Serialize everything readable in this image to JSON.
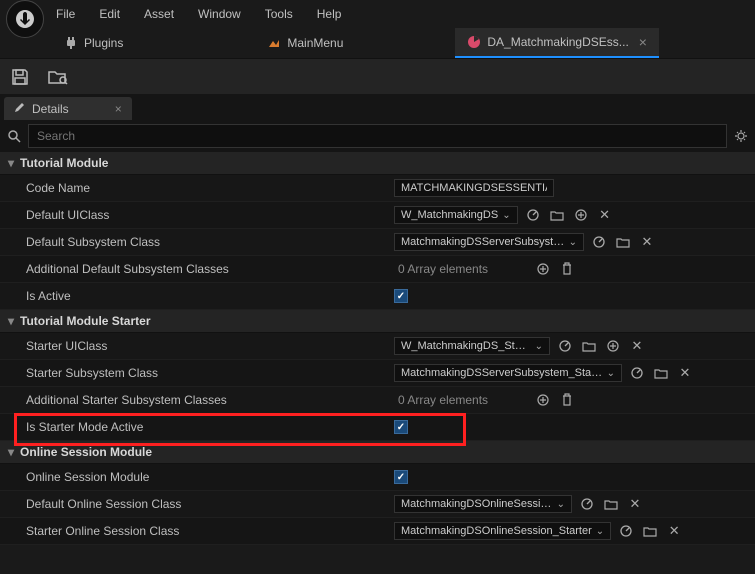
{
  "menu": {
    "file": "File",
    "edit": "Edit",
    "asset": "Asset",
    "window": "Window",
    "tools": "Tools",
    "help": "Help"
  },
  "tabs": {
    "plugins": "Plugins",
    "mainmenu": "MainMenu",
    "matchmaking": "DA_MatchmakingDSEss..."
  },
  "details_panel": {
    "title": "Details"
  },
  "search": {
    "placeholder": "Search"
  },
  "sections": {
    "tutorial_module": "Tutorial Module",
    "tutorial_module_starter": "Tutorial Module Starter",
    "online_session": "Online Session Module"
  },
  "props": {
    "code_name": {
      "label": "Code Name",
      "value": "MATCHMAKINGDSESSENTIALS"
    },
    "default_uiclass": {
      "label": "Default UIClass",
      "value": "W_MatchmakingDS"
    },
    "default_subsystem": {
      "label": "Default Subsystem Class",
      "value": "MatchmakingDSServerSubsystem"
    },
    "additional_default": {
      "label": "Additional Default Subsystem Classes",
      "value": "0 Array elements"
    },
    "is_active": {
      "label": "Is Active"
    },
    "starter_uiclass": {
      "label": "Starter UIClass",
      "value": "W_MatchmakingDS_Starter"
    },
    "starter_subsystem": {
      "label": "Starter Subsystem Class",
      "value": "MatchmakingDSServerSubsystem_Starter"
    },
    "additional_starter": {
      "label": "Additional Starter Subsystem Classes",
      "value": "0 Array elements"
    },
    "is_starter_active": {
      "label": "Is Starter Mode Active"
    },
    "online_session_module": {
      "label": "Online Session Module"
    },
    "default_online_session": {
      "label": "Default Online Session Class",
      "value": "MatchmakingDSOnlineSession"
    },
    "starter_online_session": {
      "label": "Starter Online Session Class",
      "value": "MatchmakingDSOnlineSession_Starter"
    }
  }
}
